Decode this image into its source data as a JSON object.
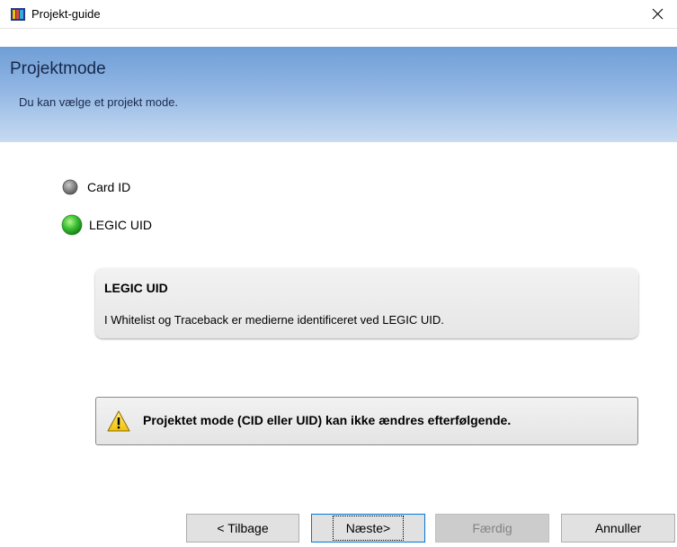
{
  "window": {
    "title": "Projekt-guide",
    "icons": {
      "app": "app-icon",
      "close": "close-icon"
    }
  },
  "header": {
    "title": "Projektmode",
    "subtitle": "Du kan vælge et projekt mode."
  },
  "options": [
    {
      "label": "Card ID",
      "selected": false,
      "icon": "radio-off-icon"
    },
    {
      "label": "LEGIC UID",
      "selected": true,
      "icon": "radio-on-icon"
    }
  ],
  "info": {
    "title": "LEGIC UID",
    "text": "I Whitelist og Traceback er medierne identificeret ved LEGIC UID."
  },
  "warning": {
    "icon": "warning-icon",
    "text": "Projektet mode (CID eller UID) kan ikke ændres efterfølgende."
  },
  "buttons": {
    "back": "< Tilbage",
    "next": "Næste>",
    "finish": "Færdig",
    "cancel": "Annuller"
  },
  "colors": {
    "header_top": "#6f9ed6",
    "header_bottom": "#c7dbf2",
    "radio_on": "#2fb52f",
    "focus_border": "#0078d7"
  }
}
